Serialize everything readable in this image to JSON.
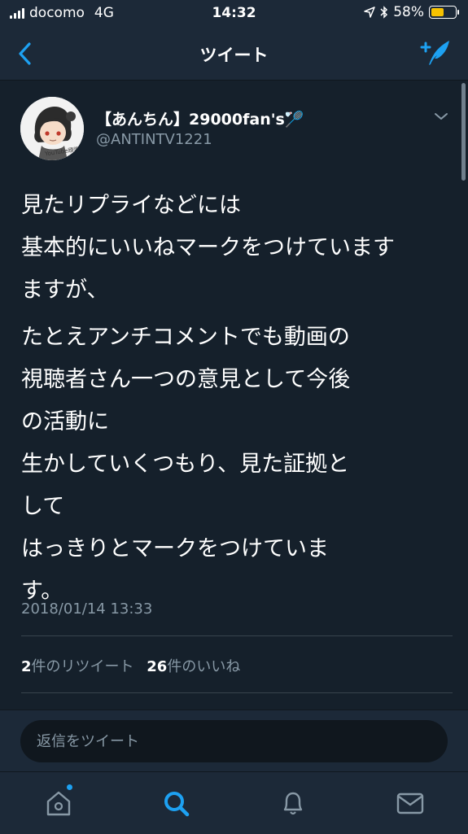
{
  "status_bar": {
    "carrier": "docomo",
    "network": "4G",
    "time": "14:32",
    "battery_percent": "58%",
    "battery_level": 0.58,
    "battery_color": "#f7c200"
  },
  "nav": {
    "title": "ツイート",
    "back_icon": "chevron-left-icon",
    "compose_icon": "compose-tweet-icon"
  },
  "tweet": {
    "display_name": "【あんちん】29000fan's",
    "name_emoji": "🏸",
    "username": "@ANTINTV1221",
    "avatar_caption": "YouTube頑張る",
    "paragraphs": [
      "見たリプライなどには\n基本的にいいねマークをつけています\nますが、",
      "たとえアンチコメントでも動画の\n視聴者さん一つの意見として今後\nの活動に\n生かしていくつもり、見た証拠と\nして\nはっきりとマークをつけていま\nす。"
    ],
    "timestamp": "2018/01/14 13:33",
    "retweet_count": "2",
    "retweet_label": "件のリツイート",
    "like_count": "26",
    "like_label": "件のいいね"
  },
  "reply": {
    "placeholder": "返信をツイート"
  },
  "tabs": [
    {
      "name": "home",
      "icon": "home-icon"
    },
    {
      "name": "search",
      "icon": "search-icon",
      "active": true
    },
    {
      "name": "notifications",
      "icon": "bell-icon"
    },
    {
      "name": "messages",
      "icon": "mail-icon"
    }
  ],
  "colors": {
    "background": "#15202b",
    "bar": "#1c2938",
    "accent": "#1da1f2",
    "muted": "#8899a6"
  }
}
